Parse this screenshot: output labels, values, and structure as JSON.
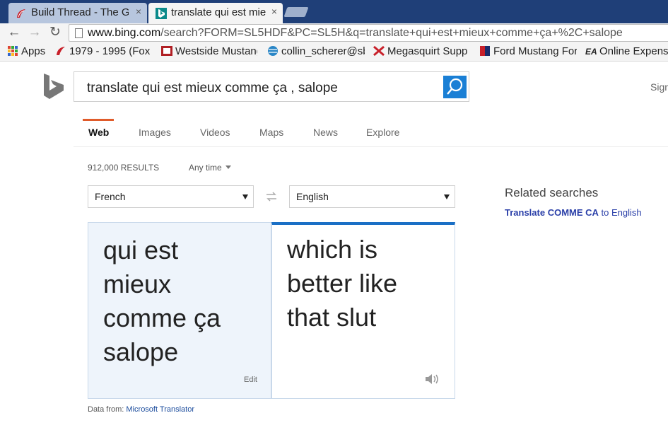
{
  "browser": {
    "tabs": [
      {
        "title": "Build Thread - The G",
        "close": "×"
      },
      {
        "title": "translate qui est mie",
        "close": "×"
      }
    ],
    "url": {
      "host": "www.bing.com",
      "path": "/search?FORM=SL5HDF&PC=SL5H&q=translate+qui+est+mieux+comme+ça+%2C+salope"
    },
    "nav": {
      "back": "←",
      "forward": "→",
      "reload": "↻"
    },
    "bookmarks": [
      {
        "label": "Apps",
        "icon": "apps-grid-icon"
      },
      {
        "label": "1979 - 1995 (Fox)",
        "icon": "tire-icon"
      },
      {
        "label": "Westside Mustang",
        "icon": "westside-logo-icon"
      },
      {
        "label": "collin_scherer@sb",
        "icon": "att-globe-icon"
      },
      {
        "label": "Megasquirt Support",
        "icon": "megasquirt-icon"
      },
      {
        "label": "Ford Mustang Forums",
        "icon": "mustang-flag-icon"
      },
      {
        "label": "Online Expense",
        "icon": "ea-icon"
      }
    ]
  },
  "search": {
    "query": "translate qui est mieux comme ça , salope",
    "signin": "Sign"
  },
  "scopes": [
    "Web",
    "Images",
    "Videos",
    "Maps",
    "News",
    "Explore"
  ],
  "results": {
    "count": "912,000 RESULTS",
    "time_filter": "Any time"
  },
  "translator": {
    "source_lang": "French",
    "target_lang": "English",
    "source_text": "qui est\nmieux\ncomme ça\nsalope",
    "target_text": "which is\nbetter like\nthat slut",
    "edit_label": "Edit",
    "data_from_label": "Data from:",
    "data_from_link": "Microsoft Translator"
  },
  "related": {
    "title": "Related searches",
    "link_bold": "Translate COMME CA",
    "link_rest": " to English"
  },
  "colors": {
    "tabstrip": "#1f3f78",
    "bing_blue": "#1a7fd5",
    "active_scope_underline": "#e05b2a",
    "translator_accent": "#1a6fc5"
  }
}
